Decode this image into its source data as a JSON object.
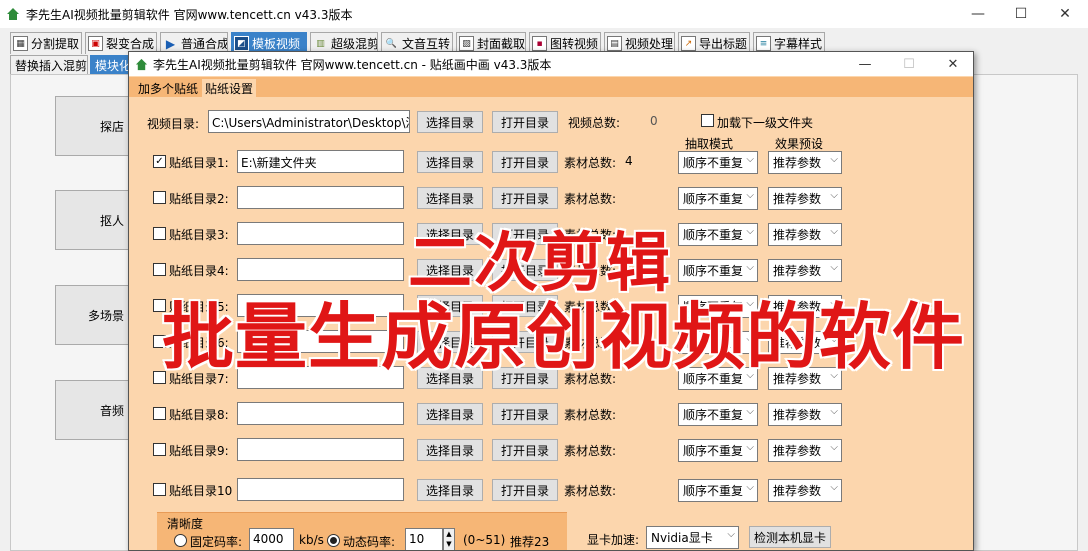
{
  "main_window": {
    "title": "李先生AI视频批量剪辑软件    官网www.tencett.cn    v43.3版本",
    "minimize": "—",
    "maximize": "☐",
    "close": "✕"
  },
  "top_tabs": [
    {
      "label": "分割提取",
      "icon": "split-icon"
    },
    {
      "label": "裂变合成",
      "icon": "fission-icon"
    },
    {
      "label": "普通合成",
      "icon": "play-icon"
    },
    {
      "label": "模板视频",
      "icon": "template-icon",
      "active": true
    },
    {
      "label": "超级混剪",
      "icon": "waveform-icon"
    },
    {
      "label": "文音互转",
      "icon": "search-text-icon"
    },
    {
      "label": "封面截取",
      "icon": "image-icon"
    },
    {
      "label": "图转视频",
      "icon": "video-frame-icon"
    },
    {
      "label": "视频处理",
      "icon": "video-icon"
    },
    {
      "label": "导出标题",
      "icon": "export-icon"
    },
    {
      "label": "字幕样式",
      "icon": "subtitle-icon"
    }
  ],
  "sub_tabs": [
    {
      "label": "替换插入混剪"
    },
    {
      "label": "模块化",
      "active": true
    }
  ],
  "background_buttons": [
    {
      "label": "探店"
    },
    {
      "label": "抠人"
    },
    {
      "label": "多场景"
    },
    {
      "label": "音频"
    }
  ],
  "dialog": {
    "title": "李先生AI视频批量剪辑软件    官网www.tencett.cn  -  贴纸画中画    v43.3版本",
    "tabs": [
      {
        "label": "加多个贴纸"
      },
      {
        "label": "贴纸设置",
        "active": true
      }
    ],
    "video_dir_label": "视频目录:",
    "video_dir_value": "C:\\Users\\Administrator\\Desktop\\演示",
    "select_dir": "选择目录",
    "open_dir": "打开目录",
    "video_total_label": "视频总数:",
    "video_total_value": "0",
    "load_subfolder_label": "加载下一级文件夹",
    "col_extract_mode": "抽取模式",
    "col_effect_preset": "效果预设",
    "material_total_label": "素材总数:",
    "rows": [
      {
        "label": "贴纸目录1:",
        "checked": true,
        "path": "E:\\新建文件夹",
        "count": "4",
        "mode": "顺序不重复",
        "preset": "推荐参数"
      },
      {
        "label": "贴纸目录2:",
        "checked": false,
        "path": "",
        "count": "",
        "mode": "顺序不重复",
        "preset": "推荐参数"
      },
      {
        "label": "贴纸目录3:",
        "checked": false,
        "path": "",
        "count": "",
        "mode": "顺序不重复",
        "preset": "推荐参数"
      },
      {
        "label": "贴纸目录4:",
        "checked": false,
        "path": "",
        "count": "",
        "mode": "顺序不重复",
        "preset": "推荐参数"
      },
      {
        "label": "贴纸目录5:",
        "checked": false,
        "path": "",
        "count": "",
        "mode": "顺序不重复",
        "preset": "推荐参数"
      },
      {
        "label": "贴纸目录6:",
        "checked": false,
        "path": "",
        "count": "",
        "mode": "顺序不重复",
        "preset": "推荐参数"
      },
      {
        "label": "贴纸目录7:",
        "checked": false,
        "path": "",
        "count": "",
        "mode": "顺序不重复",
        "preset": "推荐参数"
      },
      {
        "label": "贴纸目录8:",
        "checked": false,
        "path": "",
        "count": "",
        "mode": "顺序不重复",
        "preset": "推荐参数"
      },
      {
        "label": "贴纸目录9:",
        "checked": false,
        "path": "",
        "count": "",
        "mode": "顺序不重复",
        "preset": "推荐参数"
      },
      {
        "label": "贴纸目录10",
        "checked": false,
        "path": "",
        "count": "",
        "mode": "顺序不重复",
        "preset": "推荐参数"
      }
    ],
    "clarity_group": "清晰度",
    "fixed_bitrate_label": "固定码率:",
    "fixed_bitrate_value": "4000",
    "bitrate_unit": "kb/s",
    "dynamic_bitrate_label": "动态码率:",
    "dynamic_bitrate_value": "10",
    "range_hint": "(0~51)",
    "recommend": "推荐23",
    "gpu_label": "显卡加速:",
    "gpu_value": "Nvidia显卡",
    "detect_gpu": "检测本机显卡"
  },
  "overlay": {
    "line1": "二次剪辑",
    "line2": "批量生成原创视频的软件"
  },
  "colors": {
    "dialog_bg": "#fcd6ad",
    "dialog_tabbar": "#f6b676",
    "active_tab": "#3a82c9",
    "overlay_text": "#e01616"
  }
}
